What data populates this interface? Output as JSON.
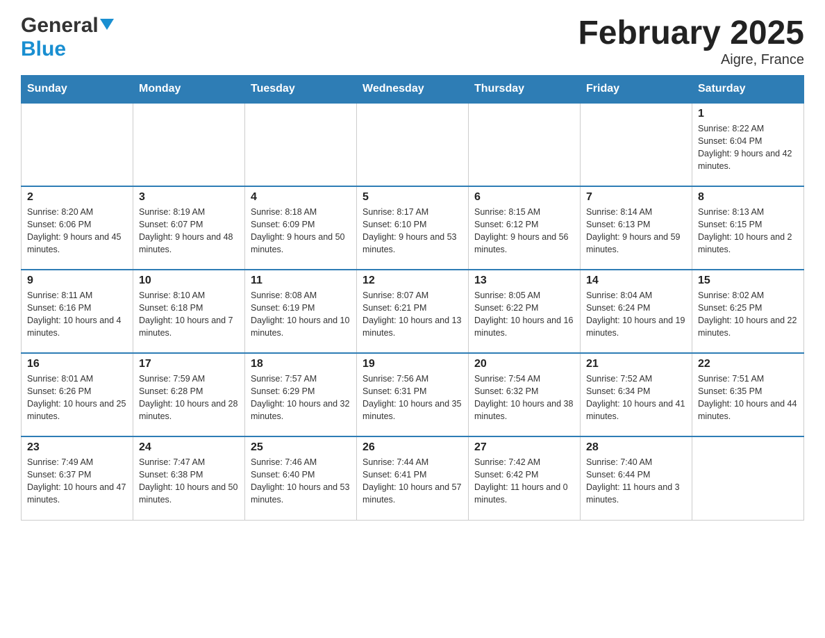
{
  "header": {
    "logo_general": "General",
    "logo_blue": "Blue",
    "month_title": "February 2025",
    "location": "Aigre, France"
  },
  "days_of_week": [
    "Sunday",
    "Monday",
    "Tuesday",
    "Wednesday",
    "Thursday",
    "Friday",
    "Saturday"
  ],
  "weeks": [
    [
      {
        "day": "",
        "info": ""
      },
      {
        "day": "",
        "info": ""
      },
      {
        "day": "",
        "info": ""
      },
      {
        "day": "",
        "info": ""
      },
      {
        "day": "",
        "info": ""
      },
      {
        "day": "",
        "info": ""
      },
      {
        "day": "1",
        "info": "Sunrise: 8:22 AM\nSunset: 6:04 PM\nDaylight: 9 hours and 42 minutes."
      }
    ],
    [
      {
        "day": "2",
        "info": "Sunrise: 8:20 AM\nSunset: 6:06 PM\nDaylight: 9 hours and 45 minutes."
      },
      {
        "day": "3",
        "info": "Sunrise: 8:19 AM\nSunset: 6:07 PM\nDaylight: 9 hours and 48 minutes."
      },
      {
        "day": "4",
        "info": "Sunrise: 8:18 AM\nSunset: 6:09 PM\nDaylight: 9 hours and 50 minutes."
      },
      {
        "day": "5",
        "info": "Sunrise: 8:17 AM\nSunset: 6:10 PM\nDaylight: 9 hours and 53 minutes."
      },
      {
        "day": "6",
        "info": "Sunrise: 8:15 AM\nSunset: 6:12 PM\nDaylight: 9 hours and 56 minutes."
      },
      {
        "day": "7",
        "info": "Sunrise: 8:14 AM\nSunset: 6:13 PM\nDaylight: 9 hours and 59 minutes."
      },
      {
        "day": "8",
        "info": "Sunrise: 8:13 AM\nSunset: 6:15 PM\nDaylight: 10 hours and 2 minutes."
      }
    ],
    [
      {
        "day": "9",
        "info": "Sunrise: 8:11 AM\nSunset: 6:16 PM\nDaylight: 10 hours and 4 minutes."
      },
      {
        "day": "10",
        "info": "Sunrise: 8:10 AM\nSunset: 6:18 PM\nDaylight: 10 hours and 7 minutes."
      },
      {
        "day": "11",
        "info": "Sunrise: 8:08 AM\nSunset: 6:19 PM\nDaylight: 10 hours and 10 minutes."
      },
      {
        "day": "12",
        "info": "Sunrise: 8:07 AM\nSunset: 6:21 PM\nDaylight: 10 hours and 13 minutes."
      },
      {
        "day": "13",
        "info": "Sunrise: 8:05 AM\nSunset: 6:22 PM\nDaylight: 10 hours and 16 minutes."
      },
      {
        "day": "14",
        "info": "Sunrise: 8:04 AM\nSunset: 6:24 PM\nDaylight: 10 hours and 19 minutes."
      },
      {
        "day": "15",
        "info": "Sunrise: 8:02 AM\nSunset: 6:25 PM\nDaylight: 10 hours and 22 minutes."
      }
    ],
    [
      {
        "day": "16",
        "info": "Sunrise: 8:01 AM\nSunset: 6:26 PM\nDaylight: 10 hours and 25 minutes."
      },
      {
        "day": "17",
        "info": "Sunrise: 7:59 AM\nSunset: 6:28 PM\nDaylight: 10 hours and 28 minutes."
      },
      {
        "day": "18",
        "info": "Sunrise: 7:57 AM\nSunset: 6:29 PM\nDaylight: 10 hours and 32 minutes."
      },
      {
        "day": "19",
        "info": "Sunrise: 7:56 AM\nSunset: 6:31 PM\nDaylight: 10 hours and 35 minutes."
      },
      {
        "day": "20",
        "info": "Sunrise: 7:54 AM\nSunset: 6:32 PM\nDaylight: 10 hours and 38 minutes."
      },
      {
        "day": "21",
        "info": "Sunrise: 7:52 AM\nSunset: 6:34 PM\nDaylight: 10 hours and 41 minutes."
      },
      {
        "day": "22",
        "info": "Sunrise: 7:51 AM\nSunset: 6:35 PM\nDaylight: 10 hours and 44 minutes."
      }
    ],
    [
      {
        "day": "23",
        "info": "Sunrise: 7:49 AM\nSunset: 6:37 PM\nDaylight: 10 hours and 47 minutes."
      },
      {
        "day": "24",
        "info": "Sunrise: 7:47 AM\nSunset: 6:38 PM\nDaylight: 10 hours and 50 minutes."
      },
      {
        "day": "25",
        "info": "Sunrise: 7:46 AM\nSunset: 6:40 PM\nDaylight: 10 hours and 53 minutes."
      },
      {
        "day": "26",
        "info": "Sunrise: 7:44 AM\nSunset: 6:41 PM\nDaylight: 10 hours and 57 minutes."
      },
      {
        "day": "27",
        "info": "Sunrise: 7:42 AM\nSunset: 6:42 PM\nDaylight: 11 hours and 0 minutes."
      },
      {
        "day": "28",
        "info": "Sunrise: 7:40 AM\nSunset: 6:44 PM\nDaylight: 11 hours and 3 minutes."
      },
      {
        "day": "",
        "info": ""
      }
    ]
  ]
}
